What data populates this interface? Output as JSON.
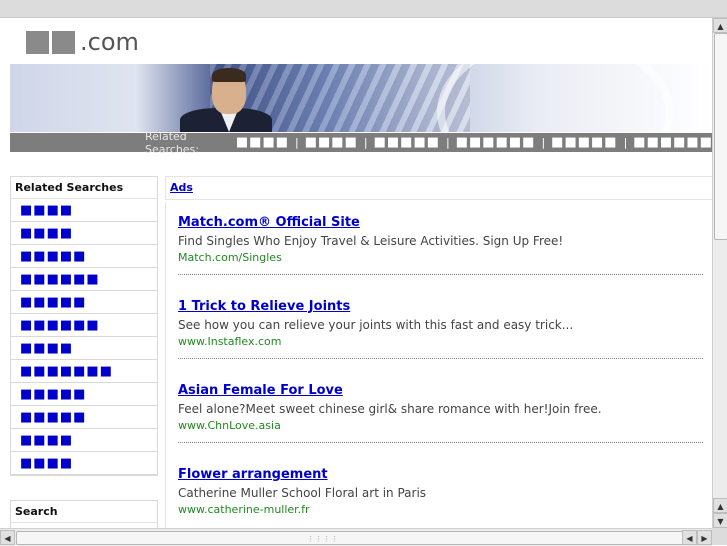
{
  "logo": {
    "blocks": "■■",
    "suffix": ".com"
  },
  "related_bar": {
    "label": "Related Searches:",
    "terms": [
      "■■■■",
      "■■■■",
      "■■■■■",
      "■■■■■■",
      "■■■■■",
      "■■■■■■"
    ],
    "separator": "|"
  },
  "sidebar": {
    "title": "Related Searches",
    "items": [
      "■■■■",
      "■■■■",
      "■■■■■",
      "■■■■■■",
      "■■■■■",
      "■■■■■■",
      "■■■■",
      "■■■■■■■",
      "■■■■■",
      "■■■■■",
      "■■■■",
      "■■■■"
    ]
  },
  "search": {
    "title": "Search"
  },
  "ads": {
    "header": "Ads",
    "items": [
      {
        "title": "Match.com® Official Site",
        "desc": "Find Singles Who Enjoy Travel & Leisure Activities. Sign Up Free!",
        "url": "Match.com/Singles"
      },
      {
        "title": "1 Trick to Relieve Joints",
        "desc": "See how you can relieve your joints with this fast and easy trick...",
        "url": "www.Instaflex.com"
      },
      {
        "title": "Asian Female For Love",
        "desc": "Feel alone?Meet sweet chinese girl& share romance with her!Join free.",
        "url": "www.ChnLove.asia"
      },
      {
        "title": "Flower arrangement",
        "desc": "Catherine Muller School Floral art in Paris",
        "url": "www.catherine-muller.fr"
      }
    ]
  },
  "scrollbars": {
    "up_arrow": "▲",
    "down_arrow": "▼",
    "left_arrow": "◀",
    "right_arrow": "▶",
    "grip": "⋮⋮⋮⋮"
  },
  "colors": {
    "link": "#0000cc",
    "url": "#228822",
    "bar": "#7d7d7d"
  }
}
